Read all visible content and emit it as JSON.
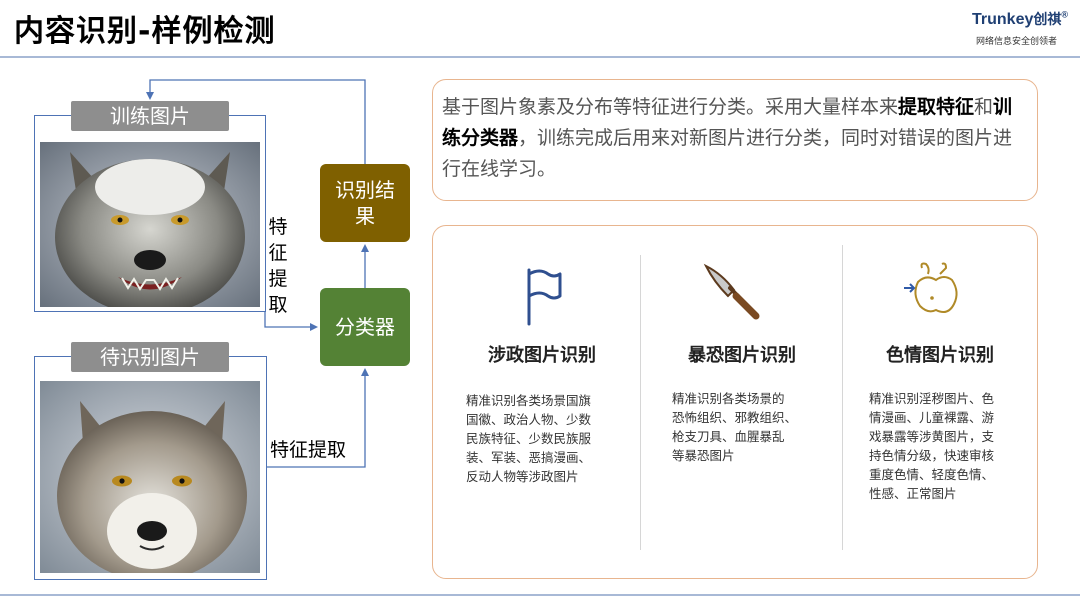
{
  "header": {
    "title": "内容识别-样例检测",
    "logo_brand": "Trunkey",
    "logo_brand_cn": "创祺",
    "logo_reg": "®",
    "logo_sub": "网络信息安全创领者"
  },
  "left": {
    "train_label": "训练图片",
    "test_label": "待识别图片",
    "feature_vertical": [
      "特",
      "征",
      "提",
      "取"
    ],
    "feature_horizontal": "特征提取",
    "result_lines": [
      "识别结",
      "果"
    ],
    "classifier": "分类器"
  },
  "description": {
    "part1": "基于图片象素及分布等特征进行分类。采用大量样本来",
    "bold1": "提取特征",
    "part2": "和",
    "bold2": "训练分类器",
    "part3": "，训练完成后用来对新图片进行分类，同时对错误的图片进行在线学习。"
  },
  "categories": [
    {
      "icon": "flag-icon",
      "title": "涉政图片识别",
      "lines": [
        "精准识别各类场景国旗",
        "国徽、政治人物、少数",
        "民族特征、少数民族服",
        "装、军装、恶搞漫画、",
        "反动人物等涉政图片"
      ]
    },
    {
      "icon": "knife-icon",
      "title": "暴恐图片识别",
      "lines": [
        "精准识别各类场景的",
        "恐怖组织、邪教组织、",
        "枪支刀具、血腥暴乱",
        "等暴恐图片"
      ]
    },
    {
      "icon": "body-icon",
      "title": "色情图片识别",
      "lines": [
        "精准识别淫秽图片、色",
        "情漫画、儿童裸露、游",
        "戏暴露等涉黄图片，支",
        "持色情分级，快速审核",
        "重度色情、轻度色情、",
        "性感、正常图片"
      ]
    }
  ],
  "colors": {
    "result_box": "#7f6000",
    "classifier_box": "#548235",
    "panel_border": "#e8b58f",
    "connector": "#4e73b5",
    "title_accent": "#1f3f73"
  }
}
